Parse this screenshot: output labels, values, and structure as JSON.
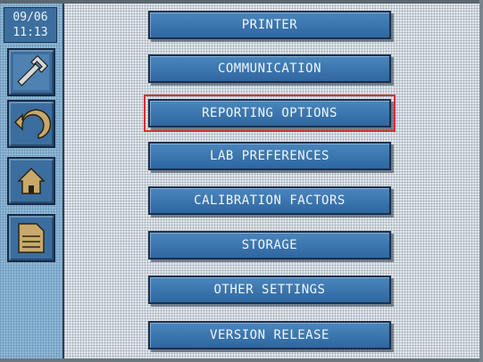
{
  "clock": {
    "date": "09/06",
    "time": "11:13"
  },
  "sidebar": {
    "buttons": [
      {
        "icon": "wrench-icon"
      },
      {
        "icon": "back-arrow-icon"
      },
      {
        "icon": "home-icon"
      },
      {
        "icon": "document-icon"
      }
    ]
  },
  "menu": {
    "selected": "REPORTING OPTIONS",
    "items": [
      {
        "label": "PRINTER"
      },
      {
        "label": "COMMUNICATION"
      },
      {
        "label": "REPORTING OPTIONS"
      },
      {
        "label": "LAB PREFERENCES"
      },
      {
        "label": "CALIBRATION FACTORS"
      },
      {
        "label": "STORAGE"
      },
      {
        "label": "OTHER SETTINGS"
      },
      {
        "label": "VERSION RELEASE"
      }
    ]
  },
  "colors": {
    "button": "#3a76b0",
    "button_border": "#1a2f4d",
    "sidebar": "#8fb9d6",
    "selection": "#d63030"
  }
}
